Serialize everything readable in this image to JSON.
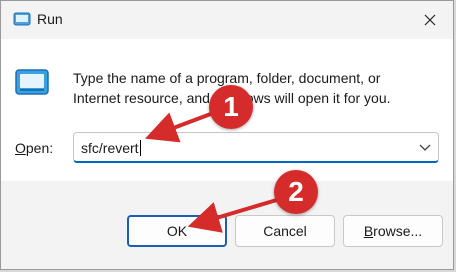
{
  "window": {
    "title": "Run",
    "close_glyph": "✕"
  },
  "dialog": {
    "description": "Type the name of a program, folder, document, or Internet resource, and Windows will open it for you.",
    "open_label_underlined": "O",
    "open_label_rest": "pen:",
    "open_value": "sfc/revert"
  },
  "buttons": {
    "ok": "OK",
    "cancel": "Cancel",
    "browse_underlined": "B",
    "browse_rest": "rowse..."
  },
  "annotations": {
    "badge_1": "1",
    "badge_2": "2",
    "color": "#d62b2b"
  },
  "colors": {
    "accent": "#0067c0",
    "annotation_red": "#d62b2b"
  },
  "icons": [
    "run-app-icon",
    "close-icon",
    "chevron-down-icon"
  ]
}
